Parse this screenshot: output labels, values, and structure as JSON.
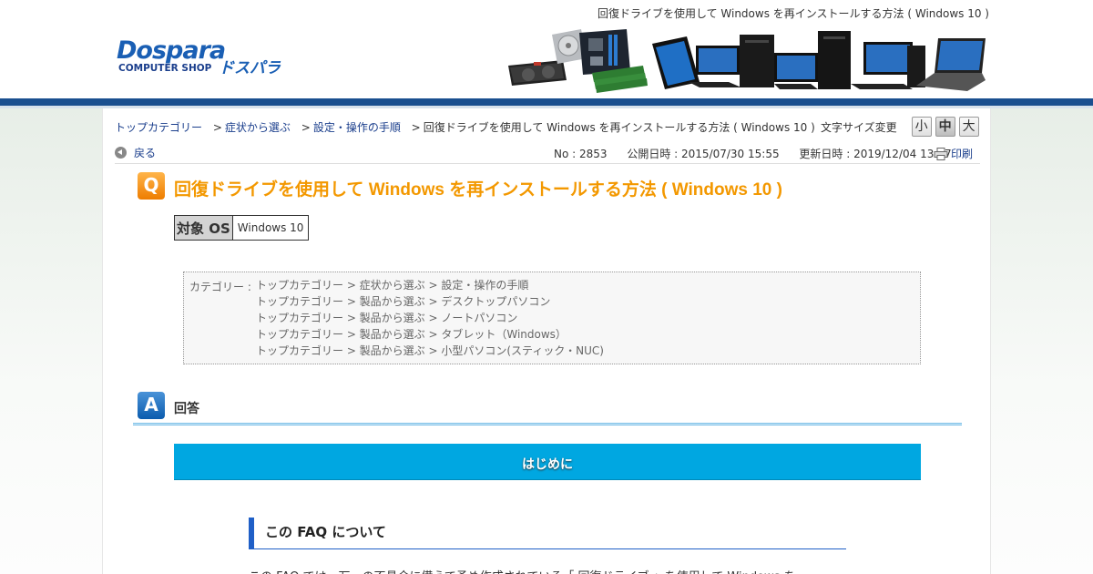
{
  "header": {
    "page_title": "回復ドライブを使用して Windows を再インストールする方法 ( Windows 10 )",
    "logo_text_main": "Dospara",
    "logo_text_sub": "COMPUTER SHOP",
    "logo_text_kana": "ドスパラ"
  },
  "breadcrumb": {
    "items": [
      "トップカテゴリー",
      "症状から選ぶ",
      "設定・操作の手順"
    ],
    "current": "回復ドライブを使用して Windows を再インストールする方法 ( Windows 10 )",
    "separator": ">"
  },
  "font_size": {
    "label": "文字サイズ変更",
    "small": "小",
    "medium": "中",
    "large": "大"
  },
  "nav": {
    "back": "戻る",
    "print": "印刷"
  },
  "meta": {
    "no": "No : 2853",
    "published": "公開日時 : 2015/07/30 15:55",
    "updated": "更新日時 : 2019/12/04 13:07"
  },
  "question": {
    "icon": "Q",
    "title": "回復ドライブを使用して Windows を再インストールする方法 ( Windows 10 )"
  },
  "target_os": {
    "key": "対象 OS",
    "value": "Windows 10"
  },
  "categories": {
    "label": "カテゴリー :",
    "items": [
      "トップカテゴリー > 症状から選ぶ > 設定・操作の手順",
      "トップカテゴリー > 製品から選ぶ > デスクトップパソコン",
      "トップカテゴリー > 製品から選ぶ > ノートパソコン",
      "トップカテゴリー > 製品から選ぶ > タブレット（Windows）",
      "トップカテゴリー > 製品から選ぶ > 小型パソコン(スティック・NUC)"
    ]
  },
  "answer": {
    "icon": "A",
    "label": "回答",
    "intro_banner": "はじめに",
    "faq_heading": "この FAQ について",
    "body_text": "この FAQ では、万一の不具合に備えて予め作成されている「 回復ドライブ 」を使用して Windows を"
  },
  "colors": {
    "brand_blue": "#1a4f8f",
    "link": "#1a3e8c",
    "question_orange": "#f39800",
    "banner_cyan": "#00a7e1",
    "heading_blue": "#1f5fc7"
  }
}
